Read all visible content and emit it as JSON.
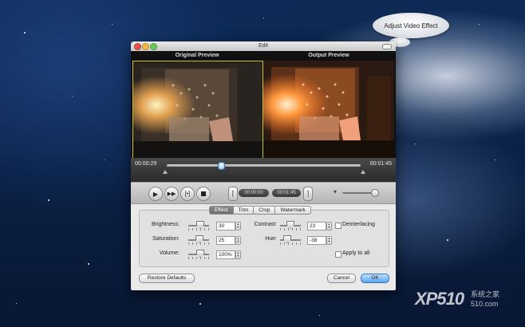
{
  "tooltip": {
    "text": "Adjust Video Effect"
  },
  "window": {
    "title": "Edit"
  },
  "preview": {
    "original_label": "Original Preview",
    "output_label": "Output Preview"
  },
  "timeline": {
    "current_time": "00:00:29",
    "total_time": "00:01:45",
    "progress": 0.28
  },
  "controls": {
    "start_time": "00:00:00",
    "end_time": "00:01:45",
    "volume_level": 0.8
  },
  "tabs": [
    "Effect",
    "Trim",
    "Crop",
    "Watermark"
  ],
  "selected_tab": "Effect",
  "effect": {
    "brightness": {
      "label": "Brightness:",
      "value": "30"
    },
    "saturation": {
      "label": "Saturation:",
      "value": "25"
    },
    "volume": {
      "label": "Volume:",
      "value": "100%"
    },
    "contrast": {
      "label": "Contrast:",
      "value": "23"
    },
    "hue": {
      "label": "Hue:",
      "value": "-38"
    },
    "deinterlacing": {
      "label": "Deinterlacing",
      "checked": false
    },
    "apply_to_all": {
      "label": "Apply to all",
      "checked": false
    }
  },
  "buttons": {
    "restore": "Restore Defaults",
    "cancel": "Cancel",
    "ok": "OK"
  },
  "watermark": {
    "logo": "XP510",
    "line1": "系统之家",
    "line2": "510.com"
  },
  "colors": {
    "ok_button": "#5aa5ee",
    "selection_border": "#c8c238",
    "desktop": "#0d2a56"
  },
  "icons": [
    "play-icon",
    "fast-forward-icon",
    "split-icon",
    "stop-icon",
    "volume-icon"
  ]
}
